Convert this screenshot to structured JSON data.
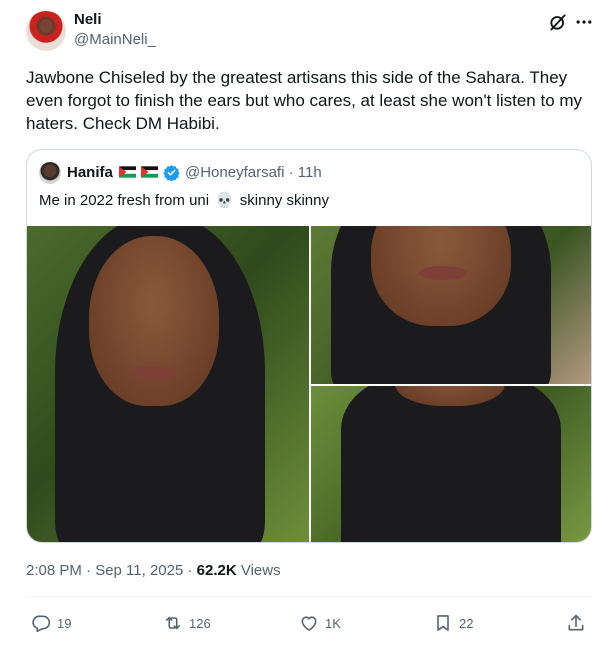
{
  "tweet": {
    "author_name": "Neli",
    "author_handle": "@MainNeli_",
    "text": "Jawbone Chiseled by the greatest artisans this side of the Sahara. They even forgot to finish the ears but who cares, at least she won't listen to my haters.  Check DM Habibi."
  },
  "quote": {
    "author_name": "Hanifa",
    "author_handle": "@Honeyfarsafi",
    "time_ago": "· 11h",
    "text_before": "Me in 2022 fresh from uni",
    "skull": "💀",
    "text_after": "skinny skinny"
  },
  "meta": {
    "timestamp": "2:08 PM · Sep 11, 2025 · ",
    "views_count": "62.2K",
    "views_label": " Views"
  },
  "actions": {
    "replies": "19",
    "reposts": "126",
    "likes": "1K",
    "bookmarks": "22"
  },
  "colors": {
    "text": "#0f1419",
    "secondary": "#536471",
    "border": "#cfd9de",
    "verified": "#1d9bf0"
  }
}
